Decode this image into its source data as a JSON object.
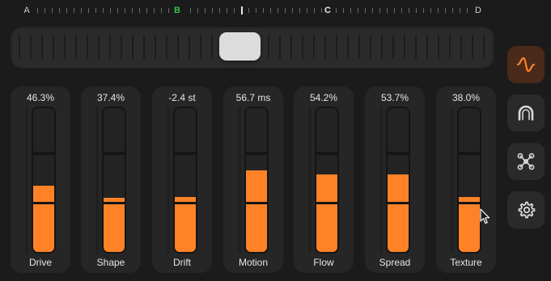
{
  "ruler": {
    "letters": [
      "A",
      "B",
      "C",
      "D"
    ],
    "active_letter": "B"
  },
  "sidebar": [
    {
      "name": "waveform-icon",
      "active": true
    },
    {
      "name": "horseshoe-icon",
      "active": false
    },
    {
      "name": "network-icon",
      "active": false
    },
    {
      "name": "gear-icon",
      "active": false
    }
  ],
  "channels": [
    {
      "label": "Drive",
      "value": "46.3%",
      "level": 0.463
    },
    {
      "label": "Shape",
      "value": "37.4%",
      "level": 0.374
    },
    {
      "label": "Drift",
      "value": "-2.4 st",
      "level": 0.38
    },
    {
      "label": "Motion",
      "value": "56.7 ms",
      "level": 0.567
    },
    {
      "label": "Flow",
      "value": "54.2%",
      "level": 0.542
    },
    {
      "label": "Spread",
      "value": "53.7%",
      "level": 0.537
    },
    {
      "label": "Texture",
      "value": "38.0%",
      "level": 0.38
    }
  ],
  "colors": {
    "accent": "#ff8227",
    "active_letter": "#39c24a",
    "background": "#1b1b1b"
  }
}
